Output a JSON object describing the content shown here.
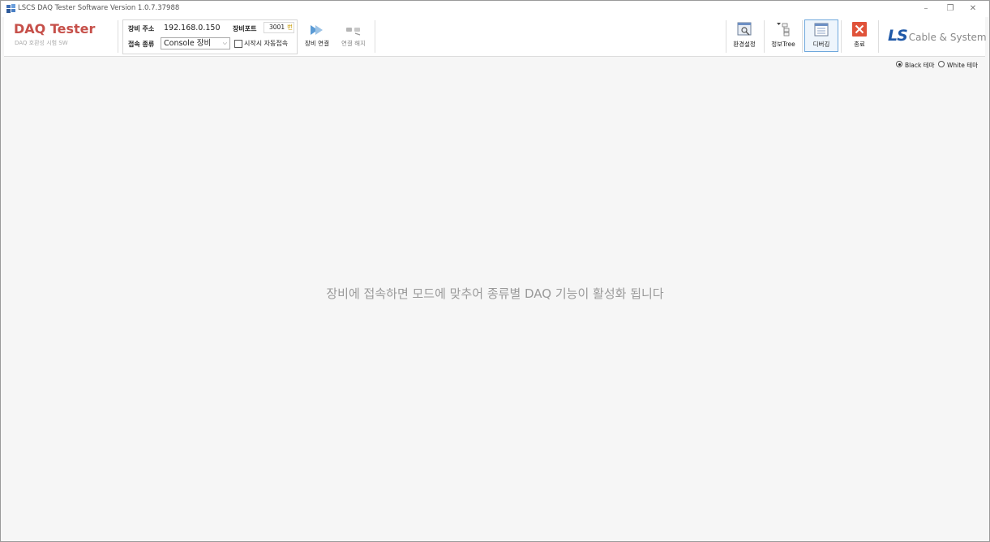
{
  "window": {
    "title": "LSCS DAQ Tester Software Version 1.0.7.37988",
    "controls": {
      "minimize": "–",
      "restore": "❐",
      "close": "✕"
    }
  },
  "brand": {
    "title": "DAQ Tester",
    "subtitle": "DAQ 호환성 시험 SW"
  },
  "connection": {
    "address_label": "장비 주소",
    "address_value": "192.168.0.150",
    "port_label": "장비포트",
    "port_value": "3001",
    "port_unit": "번",
    "type_label": "접속 종류",
    "type_value": "Console 장비",
    "autoconnect_label": "시작시 자동접속",
    "autoconnect_checked": false
  },
  "toolbar": {
    "connect_label": "장비 연결",
    "disconnect_label": "연결 해지",
    "settings_label": "환경설정",
    "infotree_label": "정보Tree",
    "debug_label": "디버깅",
    "exit_label": "종료"
  },
  "logo": {
    "mark": "LS",
    "text": "Cable & System"
  },
  "theme": {
    "black_label": "Black 테마",
    "white_label": "White 테마",
    "selected": "black"
  },
  "main": {
    "message": "장비에 접속하면 모드에 맞추어 종류별 DAQ 기능이 활성화 됩니다"
  },
  "colors": {
    "brand_title": "#c6504a",
    "exit_red": "#e0533a",
    "logo_blue": "#1f59a8",
    "active_border": "#6fa8dc"
  }
}
